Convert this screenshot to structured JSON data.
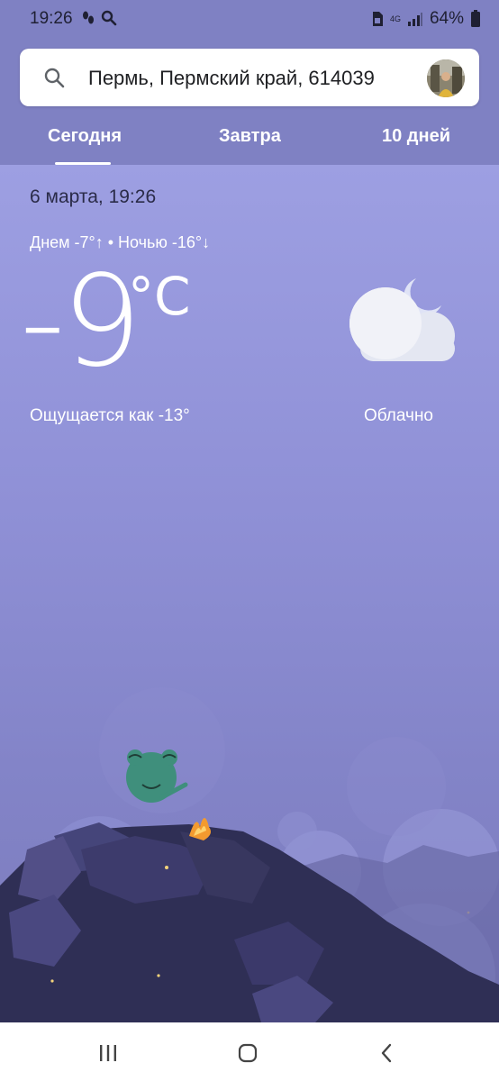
{
  "status_bar": {
    "time": "19:26",
    "network": "4G",
    "battery": "64%",
    "icons": [
      "steps-icon",
      "search-icon",
      "sim-icon",
      "signal-icon",
      "battery-icon"
    ]
  },
  "search": {
    "location": "Пермь, Пермский край, 614039"
  },
  "tabs": [
    {
      "label": "Сегодня",
      "active": true
    },
    {
      "label": "Завтра",
      "active": false
    },
    {
      "label": "10 дней",
      "active": false
    }
  ],
  "weather": {
    "date_time": "6 марта, 19:26",
    "hi_lo": "Днем -7°↑ • Ночью -16°↓",
    "temp": "-9",
    "unit": "°C",
    "feels_like": "Ощущается как -13°",
    "condition": "Облачно",
    "condition_icon": "cloudy-night-icon"
  },
  "colors": {
    "header_bg": "#7f81c3",
    "sky_top": "#9d9fe2",
    "sky_bottom": "#7b7bbb"
  }
}
